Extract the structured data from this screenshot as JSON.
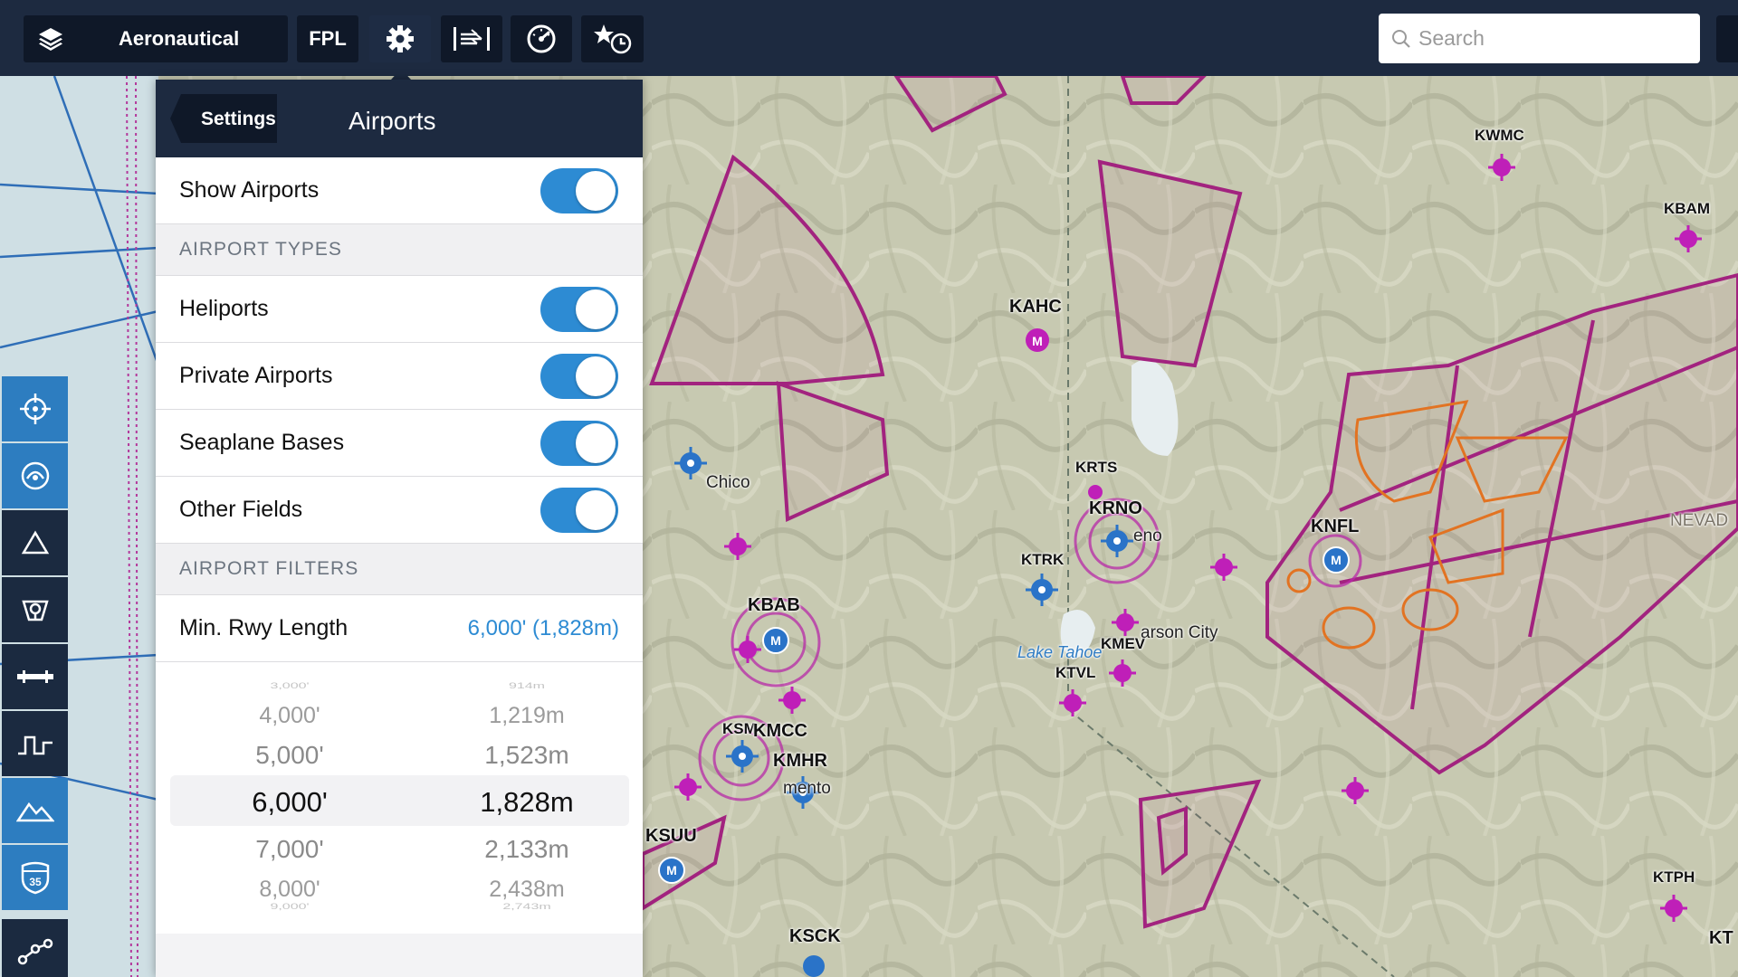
{
  "toolbar": {
    "layers_label": "Aeronautical",
    "fpl_label": "FPL",
    "search_placeholder": "Search"
  },
  "panel": {
    "back_label": "Settings",
    "title": "Airports",
    "show_airports": {
      "label": "Show Airports",
      "on": true
    },
    "section_types": "AIRPORT TYPES",
    "types": [
      {
        "label": "Heliports",
        "on": true
      },
      {
        "label": "Private Airports",
        "on": true
      },
      {
        "label": "Seaplane Bases",
        "on": true
      },
      {
        "label": "Other Fields",
        "on": true
      }
    ],
    "section_filters": "AIRPORT FILTERS",
    "min_rwy": {
      "label": "Min. Rwy Length",
      "value": "6,000' (1,828m)"
    },
    "picker": [
      {
        "ft": "3,000'",
        "m": "914m"
      },
      {
        "ft": "4,000'",
        "m": "1,219m"
      },
      {
        "ft": "5,000'",
        "m": "1,523m"
      },
      {
        "ft": "6,000'",
        "m": "1,828m"
      },
      {
        "ft": "7,000'",
        "m": "2,133m"
      },
      {
        "ft": "8,000'",
        "m": "2,438m"
      },
      {
        "ft": "9,000'",
        "m": "2,743m"
      }
    ],
    "picker_selected": "6,000'"
  },
  "map": {
    "labels": {
      "kwmc": "KWMC",
      "kbam": "KBAM",
      "kahc": "KAHC",
      "krts": "KRTS",
      "krno": "KRNO",
      "reno": "eno",
      "ktrk": "KTRK",
      "knfl": "KNFL",
      "chico": "Chico",
      "kbab": "KBAB",
      "lake_tahoe": "Lake Tahoe",
      "kmev": "KMEV",
      "carson": "arson City",
      "ktvl": "KTVL",
      "ksm": "KSM",
      "kmcc": "KMCC",
      "kmhr": "KMHR",
      "sacramento": "mento",
      "ksuu": "KSUU",
      "ksck": "KSCK",
      "ktph": "KTPH",
      "kt": "KT",
      "nevada": "NEVAD"
    },
    "colors": {
      "terrain": "#c7c9b1",
      "class_b": "#a2237f",
      "moa": "#e27322",
      "airport_blue": "#2a73c8",
      "airport_magenta": "#bf1fb8"
    }
  },
  "rail": {
    "icons": [
      "crosshair-icon",
      "radar-icon",
      "triangle-icon",
      "airport-diagram-icon",
      "runway-icon",
      "profile-icon",
      "terrain-icon",
      "shield-35-icon",
      "route-icon"
    ]
  }
}
